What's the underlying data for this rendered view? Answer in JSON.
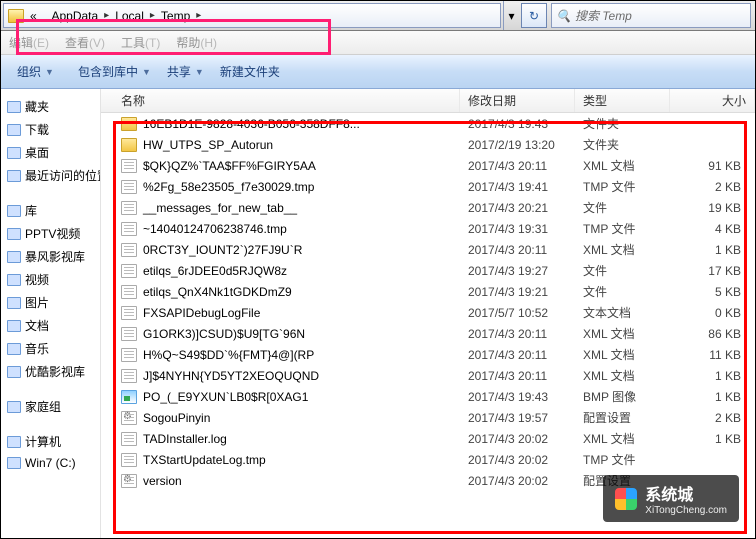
{
  "address": {
    "segments": [
      "AppData",
      "Local",
      "Temp"
    ],
    "prefix_glyph": "«"
  },
  "search": {
    "placeholder": "搜索 Temp"
  },
  "menus": [
    {
      "label": "编辑",
      "hotkey": "(E)"
    },
    {
      "label": "查看",
      "hotkey": "(V)"
    },
    {
      "label": "工具",
      "hotkey": "(T)"
    },
    {
      "label": "帮助",
      "hotkey": "(H)"
    }
  ],
  "toolbar": {
    "organize": "组织",
    "include": "包含到库中",
    "share": "共享",
    "new_folder": "新建文件夹"
  },
  "columns": {
    "name": "名称",
    "date": "修改日期",
    "type": "类型",
    "size": "大小"
  },
  "sidebar": [
    {
      "label": "藏夹"
    },
    {
      "label": "下载"
    },
    {
      "label": "桌面"
    },
    {
      "label": "最近访问的位置"
    },
    {
      "sep": true
    },
    {
      "label": "库"
    },
    {
      "label": "PPTV视频"
    },
    {
      "label": "暴风影视库"
    },
    {
      "label": "视频"
    },
    {
      "label": "图片"
    },
    {
      "label": "文档"
    },
    {
      "label": "音乐"
    },
    {
      "label": "优酷影视库"
    },
    {
      "sep": true
    },
    {
      "label": "家庭组"
    },
    {
      "sep": true
    },
    {
      "label": "计算机"
    },
    {
      "label": "Win7 (C:)"
    }
  ],
  "files": [
    {
      "name": "16EB1D1E-9828-4036-B056-358DFF8...",
      "date": "2017/4/3 19:43",
      "type": "文件夹",
      "size": "",
      "icon": "folder"
    },
    {
      "name": "HW_UTPS_SP_Autorun",
      "date": "2017/2/19 13:20",
      "type": "文件夹",
      "size": "",
      "icon": "folder"
    },
    {
      "name": "$QK}QZ%`TAA$FF%FGIRY5AA",
      "date": "2017/4/3 20:11",
      "type": "XML 文档",
      "size": "91 KB",
      "icon": "xml"
    },
    {
      "name": "%2Fg_58e23505_f7e30029.tmp",
      "date": "2017/4/3 19:41",
      "type": "TMP 文件",
      "size": "2 KB",
      "icon": "tmp"
    },
    {
      "name": "__messages_for_new_tab__",
      "date": "2017/4/3 20:21",
      "type": "文件",
      "size": "19 KB",
      "icon": "txt"
    },
    {
      "name": "~14040124706238746.tmp",
      "date": "2017/4/3 19:31",
      "type": "TMP 文件",
      "size": "4 KB",
      "icon": "tmp"
    },
    {
      "name": "0RCT3Y_IOUNT2`)27FJ9U`R",
      "date": "2017/4/3 20:11",
      "type": "XML 文档",
      "size": "1 KB",
      "icon": "xml"
    },
    {
      "name": "etilqs_6rJDEE0d5RJQW8z",
      "date": "2017/4/3 19:27",
      "type": "文件",
      "size": "17 KB",
      "icon": "txt"
    },
    {
      "name": "etilqs_QnX4Nk1tGDKDmZ9",
      "date": "2017/4/3 19:21",
      "type": "文件",
      "size": "5 KB",
      "icon": "txt"
    },
    {
      "name": "FXSAPIDebugLogFile",
      "date": "2017/5/7 10:52",
      "type": "文本文档",
      "size": "0 KB",
      "icon": "txt"
    },
    {
      "name": "G1ORK3)]CSUD)$U9[TG`96N",
      "date": "2017/4/3 20:11",
      "type": "XML 文档",
      "size": "86 KB",
      "icon": "xml"
    },
    {
      "name": "H%Q~S49$DD`%{FMT}4@](RP",
      "date": "2017/4/3 20:11",
      "type": "XML 文档",
      "size": "11 KB",
      "icon": "xml"
    },
    {
      "name": "J]$4NYHN{YD5YT2XEOQUQND",
      "date": "2017/4/3 20:11",
      "type": "XML 文档",
      "size": "1 KB",
      "icon": "xml"
    },
    {
      "name": "PO_(_E9YXUN`LB0$R[0XAG1",
      "date": "2017/4/3 19:43",
      "type": "BMP 图像",
      "size": "1 KB",
      "icon": "bmp"
    },
    {
      "name": "SogouPinyin",
      "date": "2017/4/3 19:57",
      "type": "配置设置",
      "size": "2 KB",
      "icon": "ini"
    },
    {
      "name": "TADInstaller.log",
      "date": "2017/4/3 20:02",
      "type": "XML 文档",
      "size": "1 KB",
      "icon": "xml"
    },
    {
      "name": "TXStartUpdateLog.tmp",
      "date": "2017/4/3 20:02",
      "type": "TMP 文件",
      "size": "",
      "icon": "tmp"
    },
    {
      "name": "version",
      "date": "2017/4/3 20:02",
      "type": "配置设置",
      "size": "",
      "icon": "ini"
    }
  ],
  "watermark": {
    "text": "系统城",
    "url": "XiTongCheng.com"
  }
}
